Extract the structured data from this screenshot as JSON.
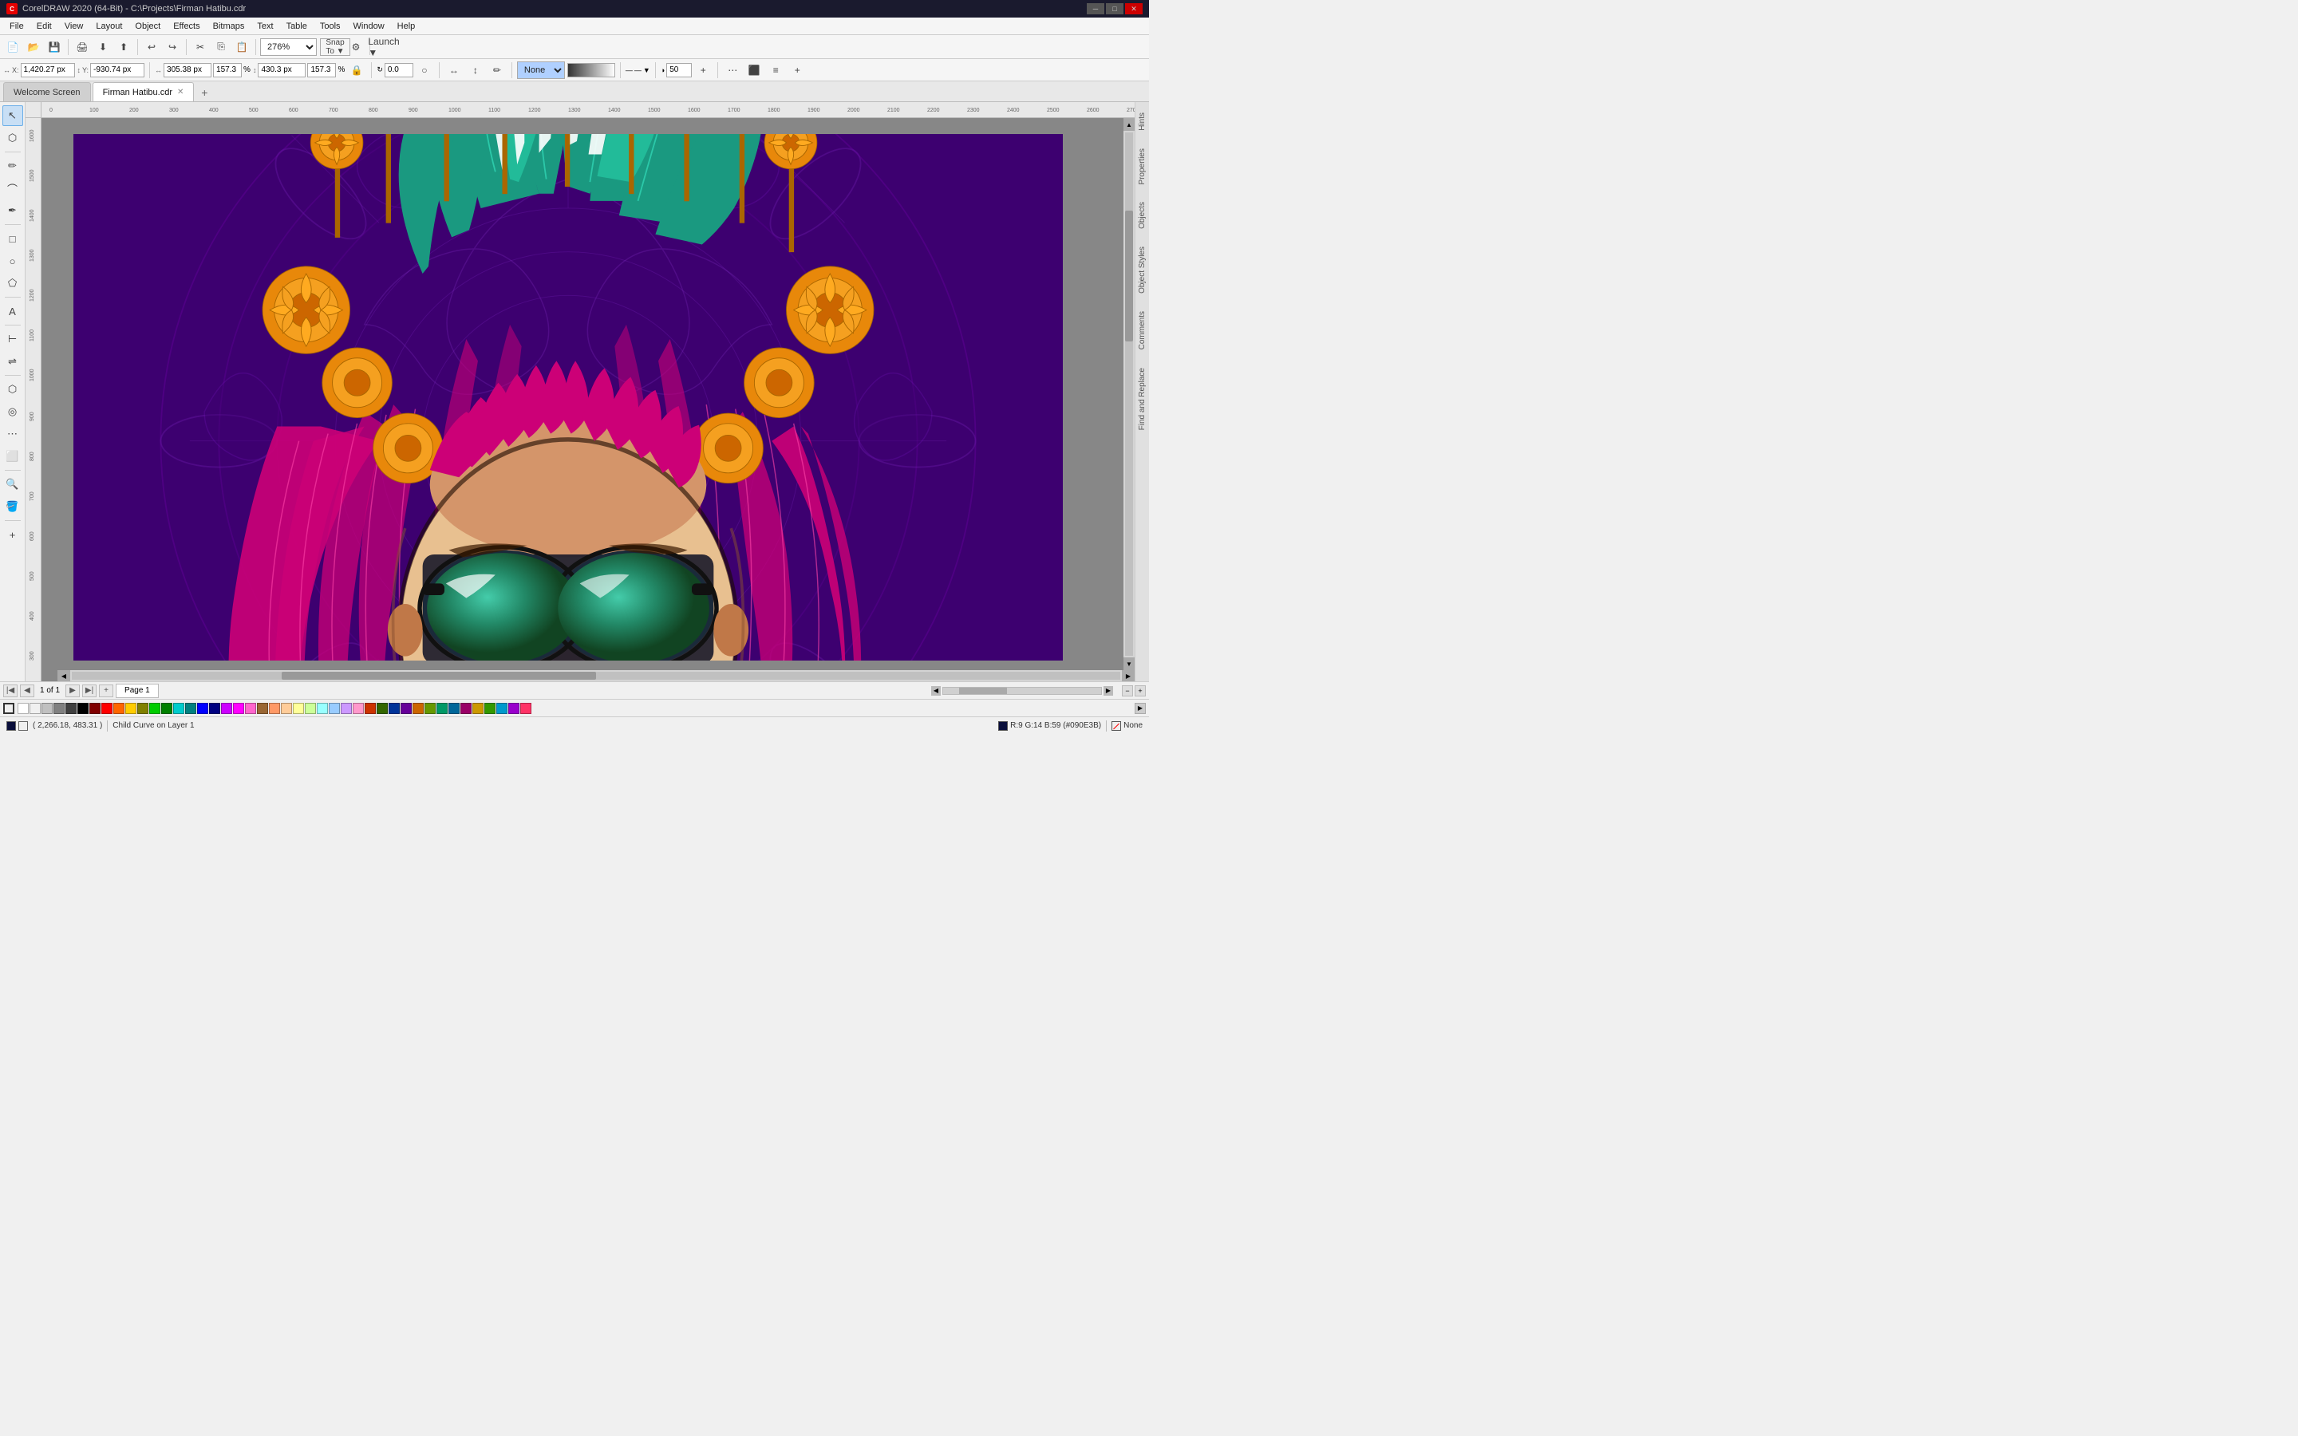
{
  "titlebar": {
    "text": "CorelDRAW 2020 (64-Bit) - C:\\Projects\\Firman Hatibu.cdr",
    "icon": "C"
  },
  "menu": {
    "items": [
      "File",
      "Edit",
      "View",
      "Layout",
      "Object",
      "Effects",
      "Bitmaps",
      "Text",
      "Table",
      "Tools",
      "Window",
      "Help"
    ]
  },
  "toolbar1": {
    "zoom_value": "276%"
  },
  "toolbar2": {
    "x_label": "X:",
    "x_value": "1,420.27 px",
    "y_label": "Y:",
    "y_value": "-930.74 px",
    "w_value": "305.38 px",
    "h_value": "430.3 px",
    "w_pct": "157.3",
    "h_pct": "157.3",
    "angle": "0.0",
    "fill_label": "None",
    "opacity_value": "50"
  },
  "tabs": [
    {
      "label": "Welcome Screen",
      "active": false,
      "closable": false
    },
    {
      "label": "Firman Hatibu.cdr",
      "active": true,
      "closable": true
    }
  ],
  "right_panel": {
    "tabs": [
      "Hints",
      "Properties",
      "Objects",
      "Object Styles",
      "Comments",
      "Find and Replace"
    ]
  },
  "status": {
    "coordinates": "( 2,266.18, 483.31 )",
    "layer": "Child Curve on Layer 1",
    "color_info": "R:9 G:14 B:59 (#090E3B)",
    "fill_none": "None"
  },
  "page": {
    "current": "1",
    "total": "1",
    "label": "Page 1"
  },
  "colors": {
    "swatches": [
      "#ffffff",
      "#000000",
      "#ff0000",
      "#ff8000",
      "#ffff00",
      "#00ff00",
      "#00ffff",
      "#0000ff",
      "#ff00ff",
      "#800080",
      "#808080",
      "#c0c0c0",
      "#800000",
      "#808000",
      "#008000",
      "#008080",
      "#000080",
      "#ff6699",
      "#ff9966",
      "#ffcc99",
      "#ccff99",
      "#99ffcc",
      "#99ccff",
      "#cc99ff",
      "#ff99cc",
      "#663300",
      "#336600",
      "#003366",
      "#660033",
      "#336633",
      "#333366",
      "#663333",
      "#ffcccc",
      "#ccffcc",
      "#ccccff",
      "#ffffcc",
      "#ffccff",
      "#ccffff",
      "#ff6666",
      "#66ff66",
      "#6666ff",
      "#ffff66",
      "#ff66ff",
      "#66ffff",
      "#cc3300",
      "#33cc00",
      "#0033cc",
      "#cc0033",
      "#33cc33",
      "#3333cc"
    ]
  }
}
